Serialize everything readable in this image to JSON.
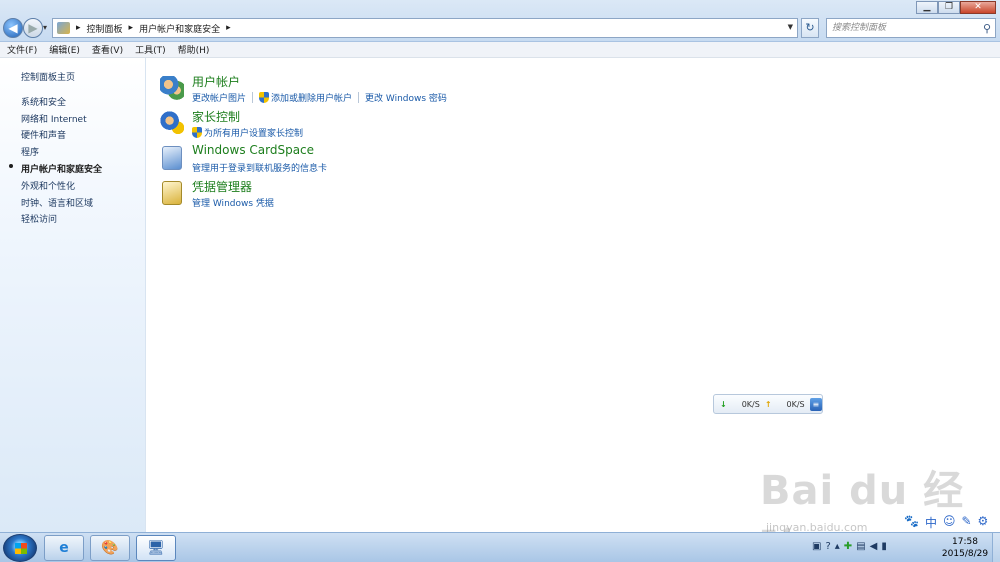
{
  "window": {
    "minimize": "▁",
    "maximize": "❐",
    "close": "✕"
  },
  "nav": {
    "back": "◀",
    "forward": "▶",
    "history": "▾",
    "breadcrumb": [
      "控制面板",
      "用户帐户和家庭安全"
    ],
    "refresh": "↻",
    "search_placeholder": "搜索控制面板"
  },
  "menu": [
    "文件(F)",
    "编辑(E)",
    "查看(V)",
    "工具(T)",
    "帮助(H)"
  ],
  "sidebar": {
    "items": [
      {
        "label": "控制面板主页"
      },
      {
        "label": "系统和安全"
      },
      {
        "label": "网络和 Internet"
      },
      {
        "label": "硬件和声音"
      },
      {
        "label": "程序"
      },
      {
        "label": "用户帐户和家庭安全",
        "active": true
      },
      {
        "label": "外观和个性化"
      },
      {
        "label": "时钟、语言和区域"
      },
      {
        "label": "轻松访问"
      }
    ]
  },
  "categories": [
    {
      "title": "用户帐户",
      "icon": "users-icon",
      "links": [
        "更改帐户图片",
        "添加或删除用户帐户",
        "更改 Windows 密码"
      ]
    },
    {
      "title": "家长控制",
      "icon": "parental-control-icon",
      "links": [
        "为所有用户设置家长控制"
      ]
    },
    {
      "title": "Windows CardSpace",
      "icon": "cardspace-icon",
      "links": [
        "管理用于登录到联机服务的信息卡"
      ]
    },
    {
      "title": "凭据管理器",
      "icon": "credential-manager-icon",
      "links": [
        "管理 Windows 凭据"
      ]
    }
  ],
  "speed_widget": {
    "down": "0K/S",
    "up": "0K/S"
  },
  "watermark": {
    "brand": "Bai du 经验",
    "url": "jingyan.baidu.com"
  },
  "ime": [
    "🐾",
    "中",
    "☺",
    "✎",
    "⚙"
  ],
  "taskbar": {
    "tasks": [
      {
        "name": "internet-explorer",
        "glyph": "e"
      },
      {
        "name": "paint",
        "glyph": "🎨"
      },
      {
        "name": "control-panel",
        "glyph": "🖥"
      }
    ],
    "tray_icons": [
      "network-status-icon",
      "help-icon",
      "chevron-up-icon",
      "antivirus-icon",
      "usb-icon",
      "volume-icon",
      "signal-icon"
    ],
    "time": "17:58",
    "date": "2015/8/29"
  },
  "colors": {
    "category_title": "#1d7e1d",
    "link": "#1a5aa8",
    "sidebar_text": "#1e3960"
  }
}
